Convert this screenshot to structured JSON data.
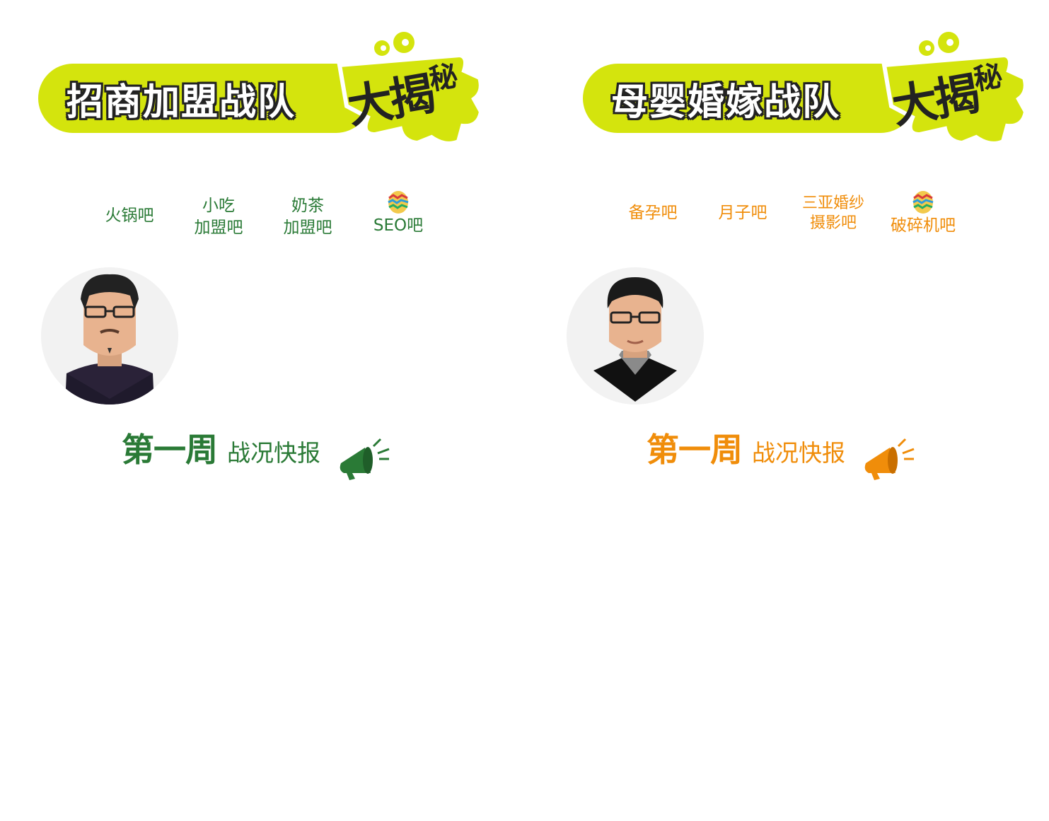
{
  "colors": {
    "banner_lime": "#d4e40d",
    "green": "#2a7a36",
    "orange": "#f08d0a"
  },
  "left": {
    "banner": {
      "title": "招商加盟战队",
      "reveal_big": "大揭",
      "reveal_small": "秘"
    },
    "categories": [
      {
        "label": "火锅吧"
      },
      {
        "label": "小吃\n加盟吧"
      },
      {
        "label": "奶茶\n加盟吧"
      },
      {
        "label": "SEO吧",
        "icon": "easter-egg-icon"
      }
    ],
    "report": {
      "week": "第一周",
      "label": "战况快报",
      "icon": "megaphone-icon"
    }
  },
  "right": {
    "banner": {
      "title": "母婴婚嫁战队",
      "reveal_big": "大揭",
      "reveal_small": "秘"
    },
    "categories": [
      {
        "label": "备孕吧"
      },
      {
        "label": "月子吧"
      },
      {
        "label": "三亚婚纱\n摄影吧"
      },
      {
        "label": "破碎机吧",
        "icon": "easter-egg-icon"
      }
    ],
    "report": {
      "week": "第一周",
      "label": "战况快报",
      "icon": "megaphone-icon"
    }
  }
}
